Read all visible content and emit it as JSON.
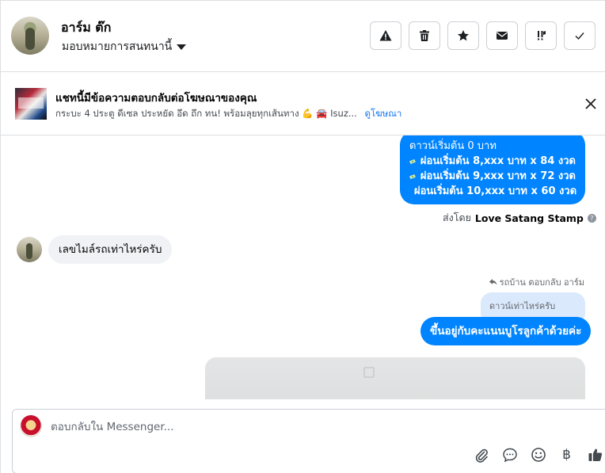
{
  "header": {
    "contact_name": "อาร์ม ต๊ก",
    "assign_label": "มอบหมายการสนทนานี้",
    "tools": [
      {
        "icon": "alert-icon"
      },
      {
        "icon": "trash-icon"
      },
      {
        "icon": "star-icon"
      },
      {
        "icon": "envelope-icon"
      },
      {
        "icon": "follow-up-icon"
      },
      {
        "icon": "check-icon"
      }
    ]
  },
  "ad_banner": {
    "title": "แชทนี้มีข้อความตอบกลับต่อโฆษณาของคุณ",
    "subtitle": "กระบะ 4 ประตู ดีเซล ประหยัด อึด ถึก ทน! พร้อมลุยทุกเส้นทาง 💪 🚘 Isuz...",
    "link": "ดูโฆษณา"
  },
  "messages": {
    "outgoing_1": {
      "line1": "ดาวน์เริ่มต้น 0 บาท",
      "line2": "ผ่อนเริ่มต้น 8,xxx บาท x 84 งวด",
      "line3": "ผ่อนเริ่มต้น 9,xxx บาท x 72 งวด",
      "line4": "ผ่อนเริ่มต้น 10,xxx บาท x 60 งวด"
    },
    "sent_by_prefix": "ส่งโดย",
    "sent_by_name": "Love Satang Stamp",
    "incoming_1": "เลขไมล์รถเท่าไหร่ครับ",
    "reply_note": "รถบ้าน ตอบกลับ อาร์ม",
    "quoted_text": "ดาวน์เท่าไหร่ครับ",
    "outgoing_2": "ขึ้นอยู่กับคะแนนบูโรลูกค้าด้วยค่ะ"
  },
  "composer": {
    "placeholder": "ตอบกลับใน Messenger...",
    "baht_symbol": "฿"
  },
  "colors": {
    "outgoing_bubble": "#0084ff",
    "incoming_bubble": "#f0f2f5",
    "quoted_bubble": "#dbe9fd",
    "link": "#1877f2",
    "border": "#dddfe2"
  }
}
